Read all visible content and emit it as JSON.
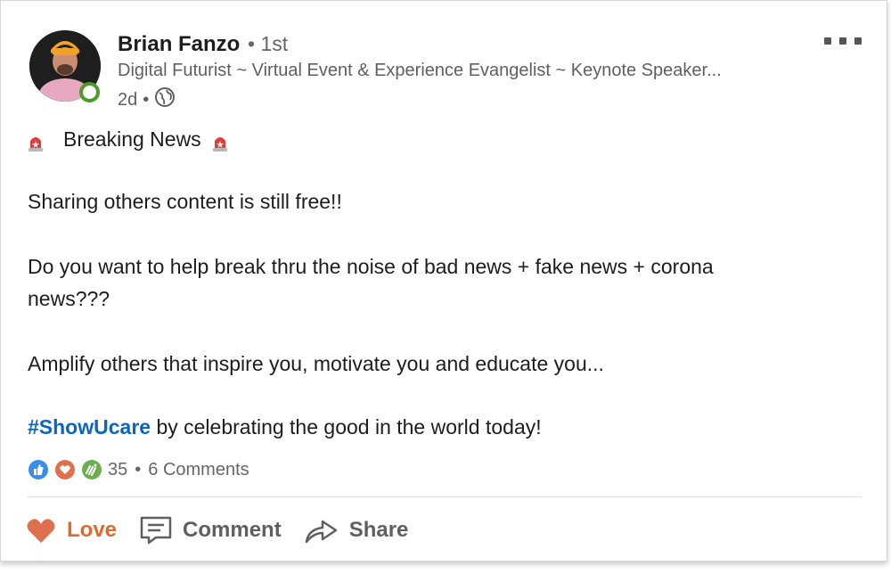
{
  "post": {
    "author": {
      "name": "Brian Fanzo",
      "degree": "• 1st",
      "headline": "Digital Futurist ~ Virtual Event & Experience Evangelist ~ Keynote Speaker...",
      "time": "2d",
      "visibility_icon": "globe-icon",
      "online_status_color": "#4c9a2a"
    },
    "lines": {
      "breaking": "Breaking News",
      "line1": "Sharing others content is still free!!",
      "line2a": "Do you want to help break thru the noise of bad news + fake news + corona",
      "line2b": "news???",
      "line3": "Amplify others that inspire you, motivate you and educate you...",
      "hashtag": "#ShowUcare",
      "line4_rest": " by celebrating the good in the world today!"
    },
    "social": {
      "reaction_icons": [
        "like-icon",
        "love-icon",
        "celebrate-icon"
      ],
      "reaction_count": "35",
      "separator": "•",
      "comments": "6 Comments"
    },
    "actions": {
      "love": "Love",
      "comment": "Comment",
      "share": "Share"
    },
    "colors": {
      "hashtag": "#0a66c2",
      "love_active": "#de6a2c",
      "muted": "#5f5f5f"
    }
  }
}
